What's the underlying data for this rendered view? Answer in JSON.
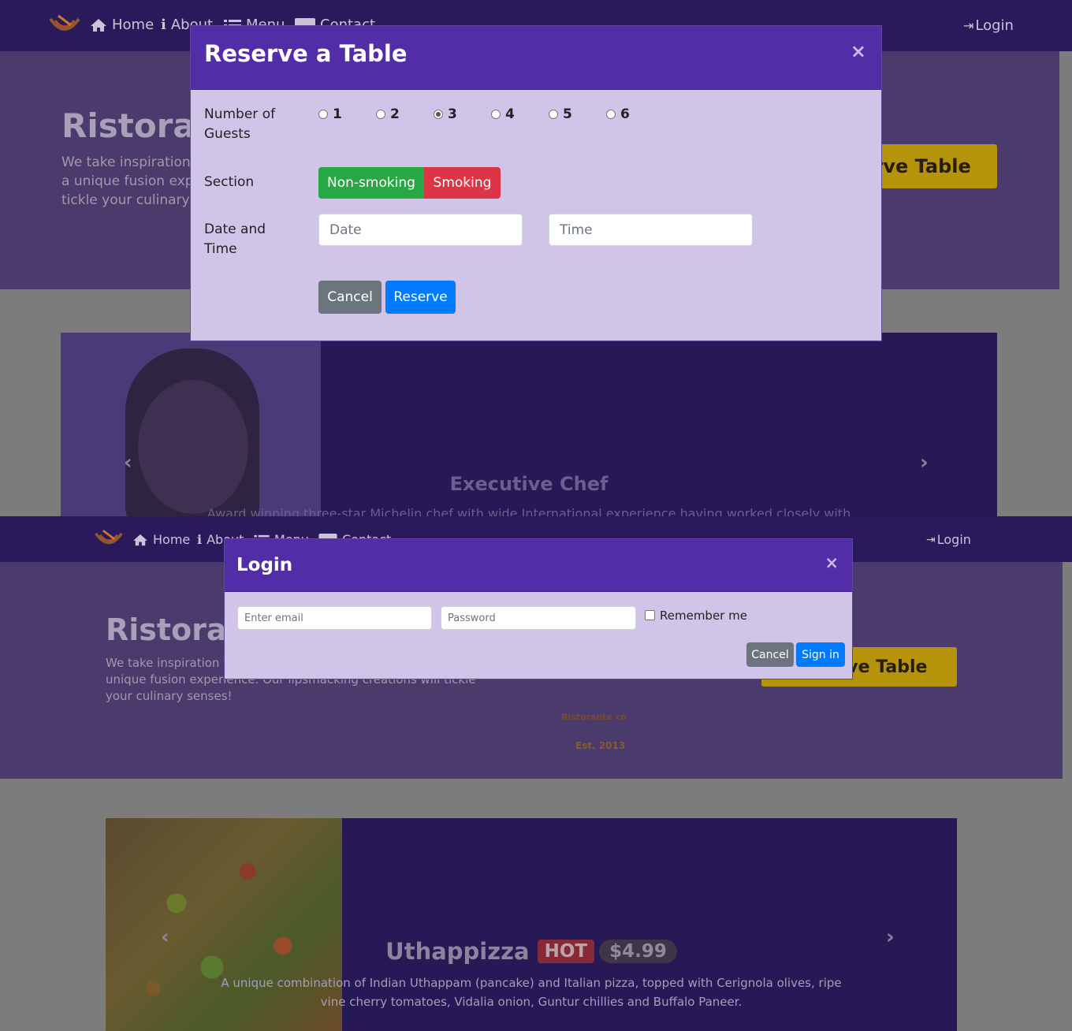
{
  "nav": {
    "home": "Home",
    "about": "About",
    "menu": "Menu",
    "contact": "Contact",
    "login": "Login"
  },
  "jumbotron": {
    "title": "Ristorante con Fusion",
    "text": "We take inspiration from the World's best cuisines, and create a unique fusion experience. Our lipsmacking creations will tickle your culinary senses!",
    "reserve_button": "Reserve Table",
    "logo_text_1": "Ristorante con Fu",
    "logo_text_2": "Est. 2013"
  },
  "carousel_top": {
    "heading": "Executive Chef",
    "text": "Award winning three-star Michelin chef with wide International experience having worked closely with"
  },
  "carousel_bottom": {
    "dish_name": "Uthappizza",
    "badge": "HOT",
    "price": "$4.99",
    "text_line1": "A unique combination of Indian Uthappam (pancake) and Italian pizza, topped with Cerignola olives, ripe",
    "text_line2": "vine cherry tomatoes, Vidalia onion, Guntur chillies and Buffalo Paneer."
  },
  "reserve_modal": {
    "title": "Reserve a Table",
    "close": "×",
    "guests_label": "Number of Guests",
    "guests_options": [
      "1",
      "2",
      "3",
      "4",
      "5",
      "6"
    ],
    "guests_selected": "3",
    "section_label": "Section",
    "section_options": [
      "Non-smoking",
      "Smoking"
    ],
    "datetime_label": "Date and Time",
    "date_placeholder": "Date",
    "time_placeholder": "Time",
    "cancel": "Cancel",
    "reserve": "Reserve"
  },
  "login_modal": {
    "title": "Login",
    "close": "×",
    "email_placeholder": "Enter email",
    "password_placeholder": "Password",
    "remember": "Remember me",
    "cancel": "Cancel",
    "signin": "Sign in"
  },
  "colors": {
    "navbar": "#2a1a5c",
    "modal_header": "#512da8",
    "modal_body": "#d1c4e9",
    "non_smoking": "#28a745",
    "smoking": "#dc3545",
    "cancel": "#6c757d",
    "primary": "#007bff",
    "hot_badge": "#dc3545"
  }
}
